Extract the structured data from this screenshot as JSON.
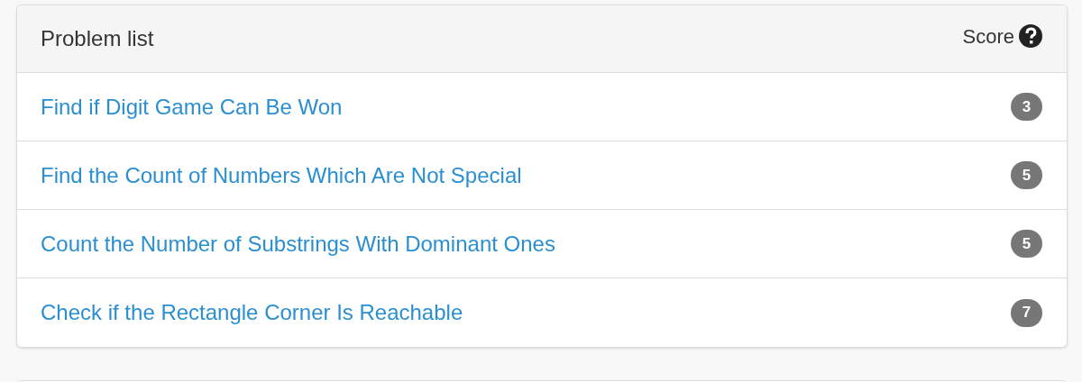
{
  "panel": {
    "title": "Problem list",
    "score_label": "Score"
  },
  "problems": [
    {
      "title": "Find if Digit Game Can Be Won",
      "score": "3"
    },
    {
      "title": "Find the Count of Numbers Which Are Not Special",
      "score": "5"
    },
    {
      "title": "Count the Number of Substrings With Dominant Ones",
      "score": "5"
    },
    {
      "title": "Check if the Rectangle Corner Is Reachable",
      "score": "7"
    }
  ]
}
